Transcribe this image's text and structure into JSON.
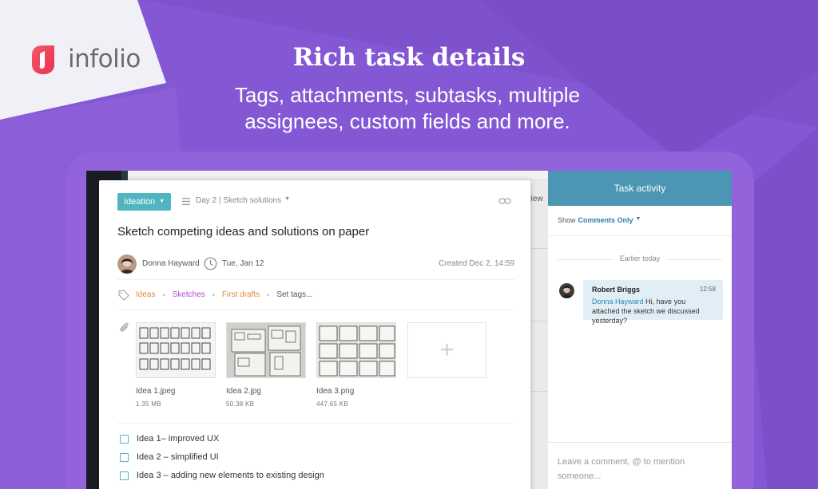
{
  "brand": {
    "name": "infolio"
  },
  "hero": {
    "headline": "Rich task details",
    "subline_1": "Tags, attachments, subtasks, multiple",
    "subline_2": "assignees, custom fields and more."
  },
  "background_fragments": {
    "header_text": "ar view"
  },
  "task": {
    "project_button": "Ideation",
    "section_link": "Day 2 | Sketch solutions",
    "title": "Sketch competing ideas and solutions on paper",
    "assignee": "Donna Hayward",
    "due_date": "Tue, Jan 12",
    "created": "Created  Dec 2, 14:59",
    "tags": [
      {
        "label": "Ideas",
        "color": "#e08a3c"
      },
      {
        "label": "Sketches",
        "color": "#b048c8"
      },
      {
        "label": "First drafts",
        "color": "#e08a3c"
      }
    ],
    "set_tags": "Set tags...",
    "attachments": [
      {
        "name": "Idea 1.jpeg",
        "size": "1.35 MB"
      },
      {
        "name": "Idea 2.jpg",
        "size": "50.38 KB"
      },
      {
        "name": "Idea 3.png",
        "size": "447.65 KB"
      }
    ],
    "subtasks": [
      "Idea 1– improved UX",
      "Idea 2 – simplified UI",
      "Idea 3 – adding new elements to existing design"
    ]
  },
  "activity": {
    "title": "Task activity",
    "filter_label": "Show",
    "filter_value": "Comments Only",
    "separator": "Earlier today",
    "comment": {
      "author": "Robert Briggs",
      "time": "12:58",
      "mention": "Donna Hayward",
      "text": " Hi, have you attached the sketch we discussed yesterday?"
    },
    "input_placeholder_1": "Leave a comment, @ to mention",
    "input_placeholder_2": "someone..."
  },
  "colors": {
    "background": "#8458d4",
    "accent_teal": "#4fb5c0",
    "activity_header": "#4a96b3",
    "brand_red": "#ef3f5a"
  }
}
